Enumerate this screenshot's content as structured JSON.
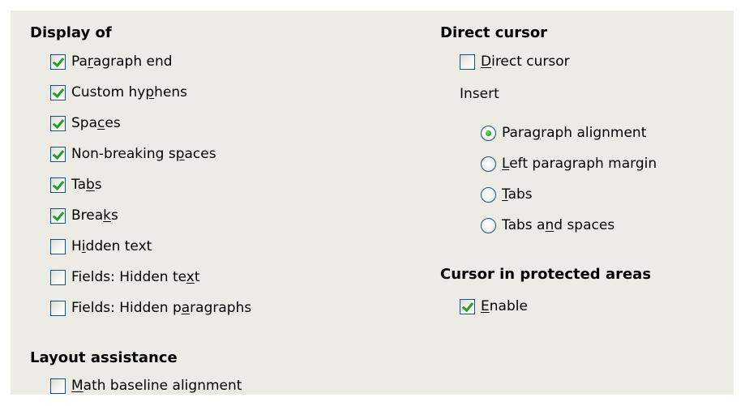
{
  "display_of": {
    "heading": "Display of",
    "items": [
      {
        "pre": "Pa",
        "key": "r",
        "post": "agraph end",
        "checked": true
      },
      {
        "pre": "Custom hy",
        "key": "p",
        "post": "hens",
        "checked": true
      },
      {
        "pre": "Spa",
        "key": "c",
        "post": "es",
        "checked": true
      },
      {
        "pre": "Non-breaking s",
        "key": "p",
        "post": "aces",
        "checked": true
      },
      {
        "pre": "Ta",
        "key": "b",
        "post": "s",
        "checked": true
      },
      {
        "pre": "Brea",
        "key": "k",
        "post": "s",
        "checked": true
      },
      {
        "pre": "H",
        "key": "i",
        "post": "dden text",
        "checked": false
      },
      {
        "pre": "Fields: Hidden te",
        "key": "x",
        "post": "t",
        "checked": false
      },
      {
        "pre": "Fields: Hidden p",
        "key": "a",
        "post": "ragraphs",
        "checked": false
      }
    ]
  },
  "layout_assistance": {
    "heading": "Layout assistance",
    "items": [
      {
        "pre": "",
        "key": "M",
        "post": "ath baseline alignment",
        "checked": false
      }
    ]
  },
  "direct_cursor": {
    "heading": "Direct cursor",
    "checkbox": {
      "pre": "",
      "key": "D",
      "post": "irect cursor",
      "checked": false
    },
    "insert_label": "Insert",
    "options": [
      {
        "pre": "Para",
        "key": "g",
        "post": "raph alignment",
        "selected": true
      },
      {
        "pre": "",
        "key": "L",
        "post": "eft paragraph margin",
        "selected": false
      },
      {
        "pre": "",
        "key": "T",
        "post": "abs",
        "selected": false
      },
      {
        "pre": "Tabs a",
        "key": "n",
        "post": "d spaces",
        "selected": false
      }
    ]
  },
  "protected": {
    "heading": "Cursor in protected areas",
    "checkbox": {
      "pre": "",
      "key": "E",
      "post": "nable",
      "checked": true
    }
  }
}
